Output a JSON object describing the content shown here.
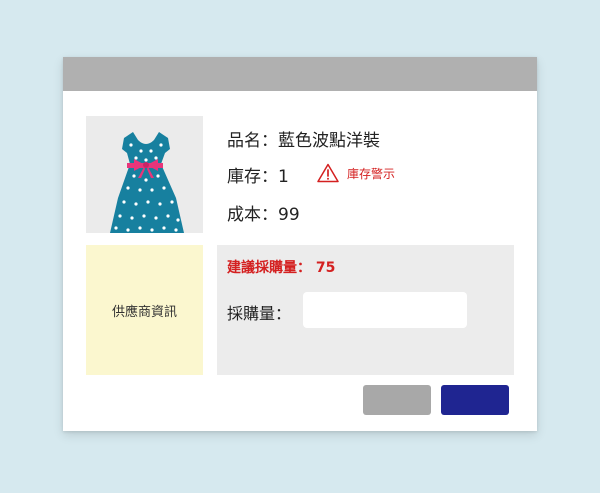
{
  "product": {
    "name_label": "品名：藍色波點洋裝",
    "stock_label": "庫存：1",
    "cost_label": "成本：99",
    "image_icon": "dress-icon",
    "image_colors": {
      "dress": "#17809f",
      "dots": "#ffffff",
      "ribbon": "#e8357a"
    }
  },
  "stock_warning": {
    "icon": "warning-triangle-icon",
    "label": "庫存警示",
    "color": "#d42020"
  },
  "supplier": {
    "label": "供應商資訊",
    "background": "#fbf7cf"
  },
  "purchase": {
    "suggested_label": "建議採購量： 75",
    "quantity_label": "採購量：",
    "quantity_value": "",
    "quantity_placeholder": ""
  },
  "buttons": {
    "cancel_color": "#a8a8a8",
    "confirm_color": "#1f2591"
  },
  "colors": {
    "page_background": "#d6e9ef",
    "titlebar": "#b0b0b0",
    "panel_background": "#ececec"
  }
}
